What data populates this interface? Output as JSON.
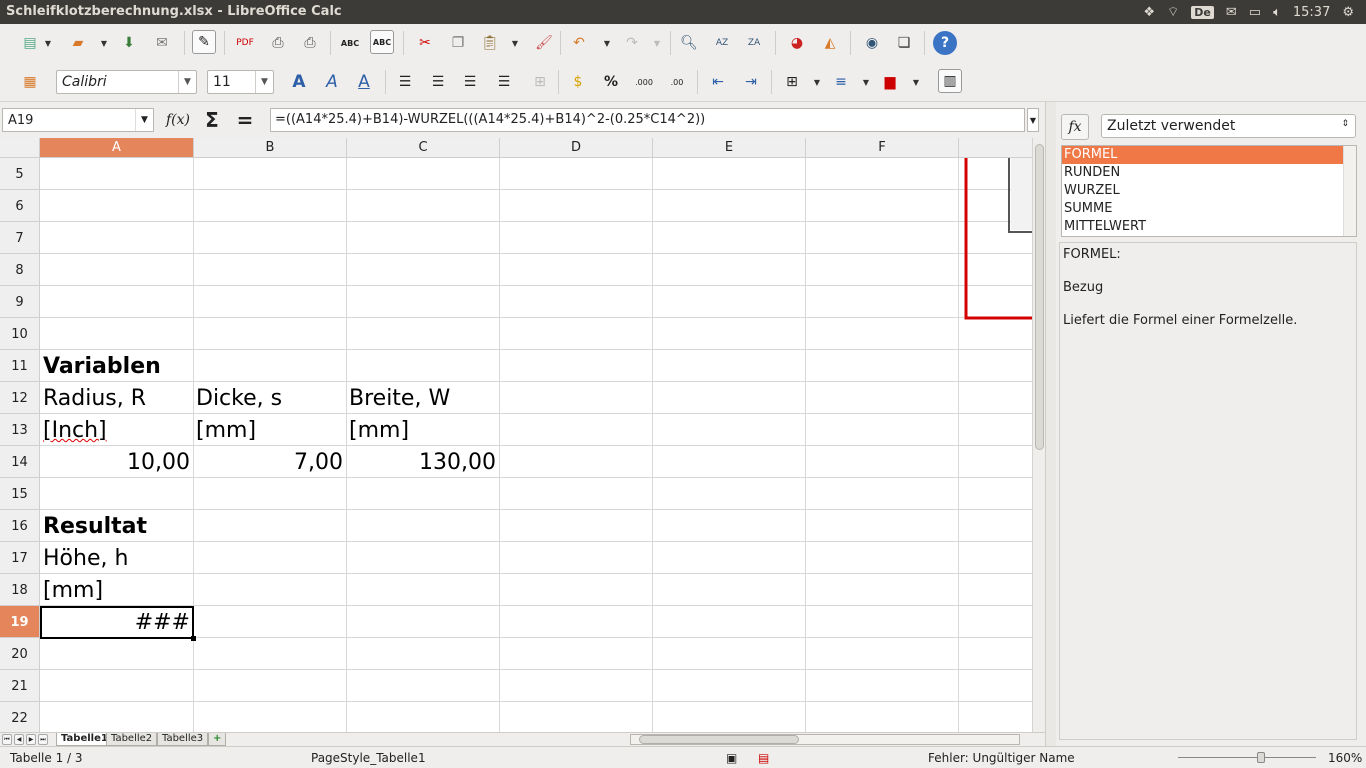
{
  "window": {
    "title": "Schleifklotzberechnung.xlsx - LibreOffice Calc"
  },
  "tray": {
    "keyboard": "De",
    "time": "15:37"
  },
  "font": {
    "name": "Calibri",
    "size": "11"
  },
  "namebox": "A19",
  "formula": "=((A14*25.4)+B14)-WURZEL(((A14*25.4)+B14)^2-(0.25*C14^2))",
  "columns": [
    "A",
    "B",
    "C",
    "D",
    "E",
    "F"
  ],
  "rows": [
    "5",
    "6",
    "7",
    "8",
    "9",
    "10",
    "11",
    "12",
    "13",
    "14",
    "15",
    "16",
    "17",
    "18",
    "19",
    "20",
    "21",
    "22"
  ],
  "cells": {
    "a11": "Variablen",
    "a12": "Radius, R",
    "b12": "Dicke, s",
    "c12": "Breite, W",
    "a13": "[Inch]",
    "b13": "[mm]",
    "c13": "[mm]",
    "a14": "10,00",
    "b14": "7,00",
    "c14": "130,00",
    "a16": "Resultat",
    "a17": "Höhe, h",
    "a18": "[mm]",
    "a19": "###"
  },
  "sheet_tabs": [
    "Tabelle1",
    "Tabelle2",
    "Tabelle3"
  ],
  "status": {
    "sheet": "Tabelle 1 / 3",
    "pagestyle": "PageStyle_Tabelle1",
    "error": "Fehler: Ungültiger Name",
    "zoom": "160%"
  },
  "sidebar": {
    "fx": "fx",
    "category": "Zuletzt verwendet",
    "functions": [
      "FORMEL",
      "RUNDEN",
      "WURZEL",
      "SUMME",
      "MITTELWERT"
    ],
    "desc_title": "FORMEL:",
    "desc_param": "Bezug",
    "desc_text": "Liefert die Formel einer Formelzelle."
  },
  "colors": {
    "accent": "#e4855c",
    "selection": "#f07746",
    "chart_border": "#d40000"
  }
}
